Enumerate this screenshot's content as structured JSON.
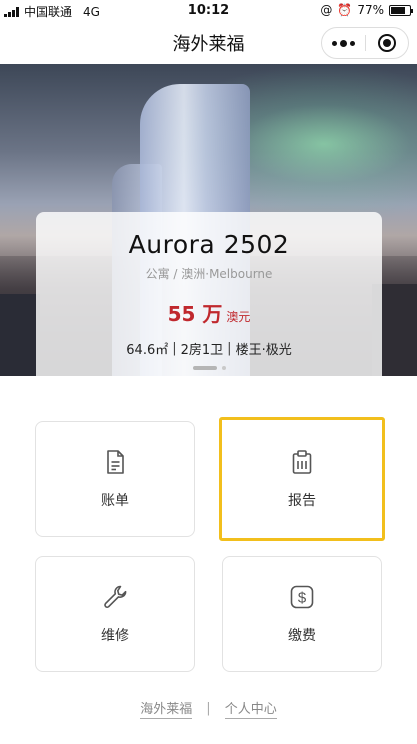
{
  "status_bar": {
    "carrier": "中国联通",
    "network": "4G",
    "time": "10:12",
    "battery": "77%",
    "battery_level": 0.77
  },
  "nav": {
    "title": "海外莱福"
  },
  "property": {
    "name": "Aurora 2502",
    "type": "公寓 / 澳洲·Melbourne",
    "price_value": "55 万",
    "price_unit": "澳元",
    "specs": [
      "64.6㎡",
      "2房1卫",
      "楼王·极光"
    ]
  },
  "tiles": {
    "bill": {
      "label": "账单",
      "icon": "document-icon"
    },
    "report": {
      "label": "报告",
      "icon": "clipboard-icon"
    },
    "repair": {
      "label": "维修",
      "icon": "wrench-icon"
    },
    "fee": {
      "label": "缴费",
      "icon": "dollar-icon"
    }
  },
  "footer": {
    "link_home": "海外莱福",
    "separator": "|",
    "link_profile": "个人中心"
  },
  "colors": {
    "price": "#c0282d",
    "selected_border": "#f2bf1c"
  }
}
